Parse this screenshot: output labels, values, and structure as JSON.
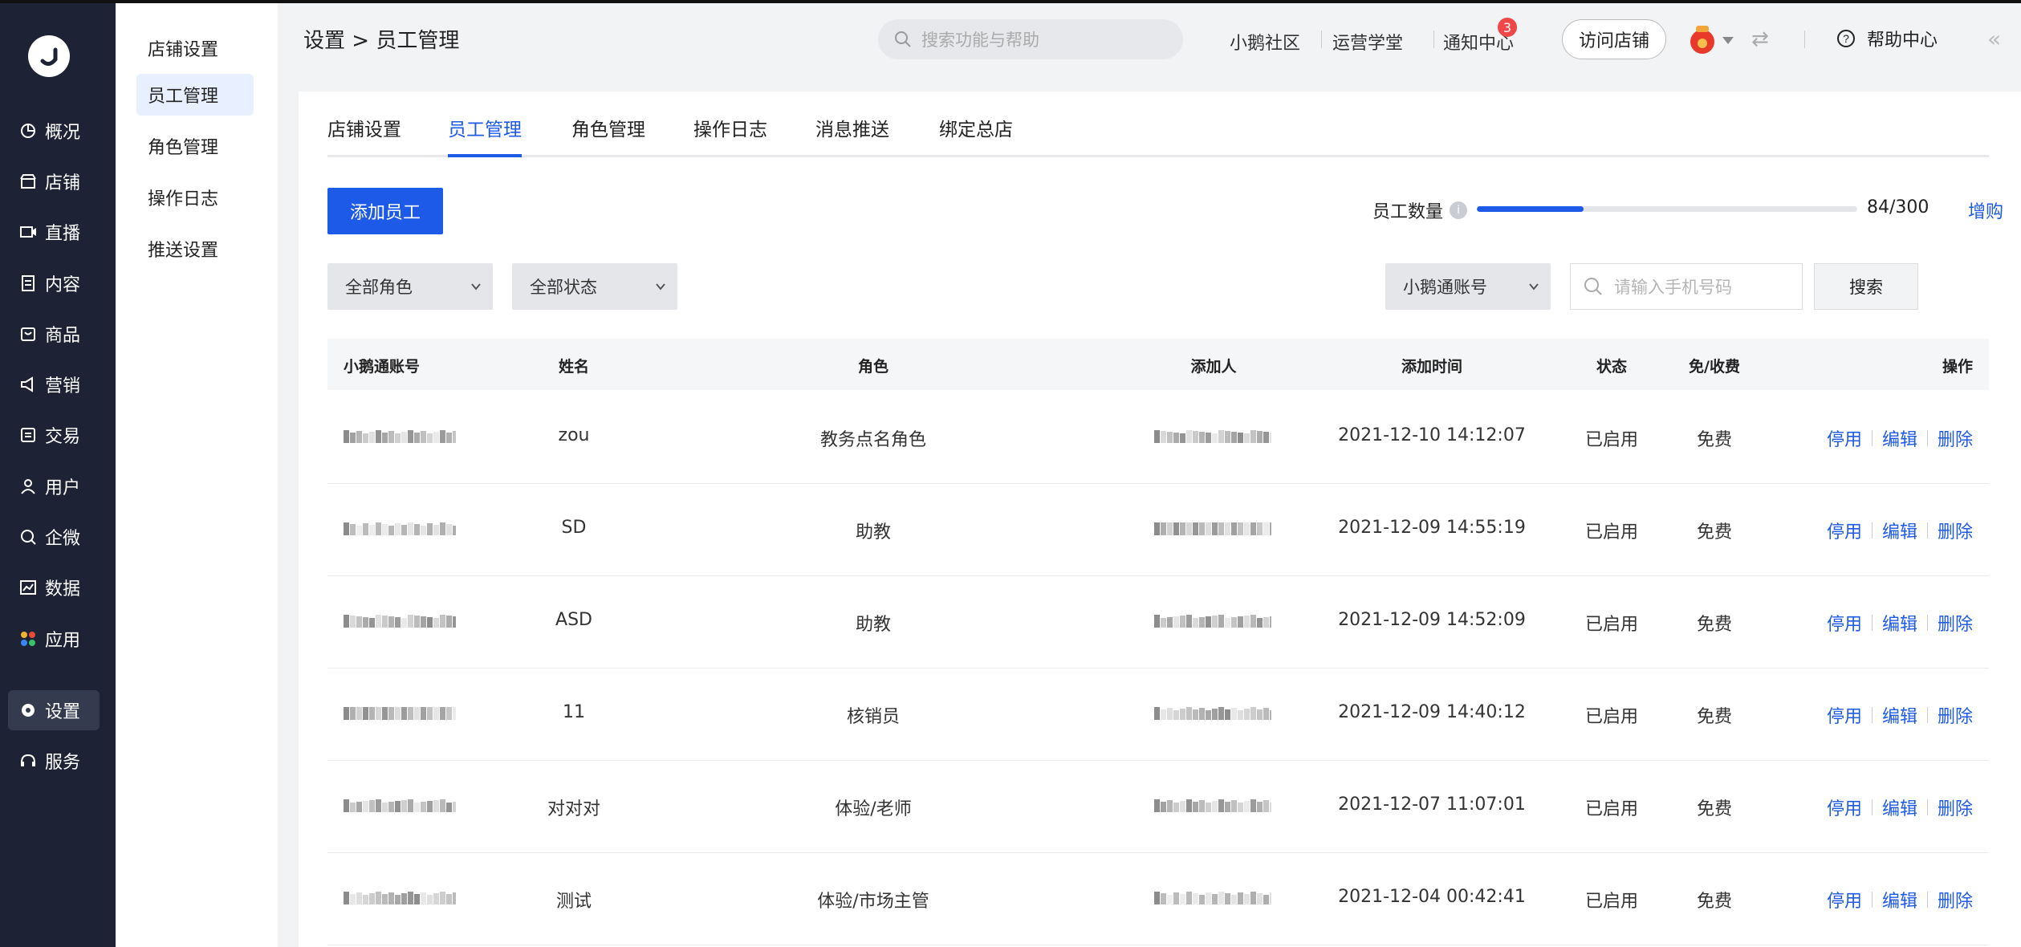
{
  "nav": {
    "items": [
      {
        "label": "概况",
        "icon": "pie-chart-icon"
      },
      {
        "label": "店铺",
        "icon": "store-icon"
      },
      {
        "label": "直播",
        "icon": "live-icon"
      },
      {
        "label": "内容",
        "icon": "document-icon"
      },
      {
        "label": "商品",
        "icon": "bag-icon"
      },
      {
        "label": "营销",
        "icon": "megaphone-icon"
      },
      {
        "label": "交易",
        "icon": "trade-icon"
      },
      {
        "label": "用户",
        "icon": "user-icon"
      },
      {
        "label": "企微",
        "icon": "chat-icon"
      },
      {
        "label": "数据",
        "icon": "chart-icon"
      },
      {
        "label": "应用",
        "icon": "apps-icon"
      },
      {
        "label": "设置",
        "icon": "gear-icon",
        "active": true
      },
      {
        "label": "服务",
        "icon": "service-icon"
      }
    ]
  },
  "side": {
    "items": [
      "店铺设置",
      "员工管理",
      "角色管理",
      "操作日志",
      "推送设置"
    ],
    "active_index": 1
  },
  "header": {
    "breadcrumb": "设置 > 员工管理",
    "search_placeholder": "搜索功能与帮助",
    "links": [
      "小鹅社区",
      "运营学堂",
      "通知中心"
    ],
    "notify_count": "3",
    "visit_store": "访问店铺",
    "help": "帮助中心"
  },
  "tabs": [
    "店铺设置",
    "员工管理",
    "角色管理",
    "操作日志",
    "消息推送",
    "绑定总店"
  ],
  "toolbar": {
    "add_label": "添加员工",
    "count_label": "员工数量",
    "count_value": "84/300",
    "count_fraction": 0.28,
    "expand_label": "增购",
    "role_select": "全部角色",
    "status_select": "全部状态",
    "account_select": "小鹅通账号",
    "phone_placeholder": "请输入手机号码",
    "search_label": "搜索"
  },
  "table": {
    "columns": [
      "小鹅通账号",
      "姓名",
      "角色",
      "添加人",
      "添加时间",
      "状态",
      "免/收费",
      "操作"
    ],
    "actions": [
      "停用",
      "编辑",
      "删除"
    ],
    "rows": [
      {
        "name": "zou",
        "role": "教务点名角色",
        "time": "2021-12-10 14:12:07",
        "status": "已启用",
        "fee": "免费"
      },
      {
        "name": "SD",
        "role": "助教",
        "time": "2021-12-09 14:55:19",
        "status": "已启用",
        "fee": "免费"
      },
      {
        "name": "ASD",
        "role": "助教",
        "time": "2021-12-09 14:52:09",
        "status": "已启用",
        "fee": "免费"
      },
      {
        "name": "11",
        "role": "核销员",
        "time": "2021-12-09 14:40:12",
        "status": "已启用",
        "fee": "免费"
      },
      {
        "name": "对对对",
        "role": "体验/老师",
        "time": "2021-12-07 11:07:01",
        "status": "已启用",
        "fee": "免费"
      },
      {
        "name": "测试",
        "role": "体验/市场主管",
        "time": "2021-12-04 00:42:41",
        "status": "已启用",
        "fee": "免费"
      }
    ]
  }
}
